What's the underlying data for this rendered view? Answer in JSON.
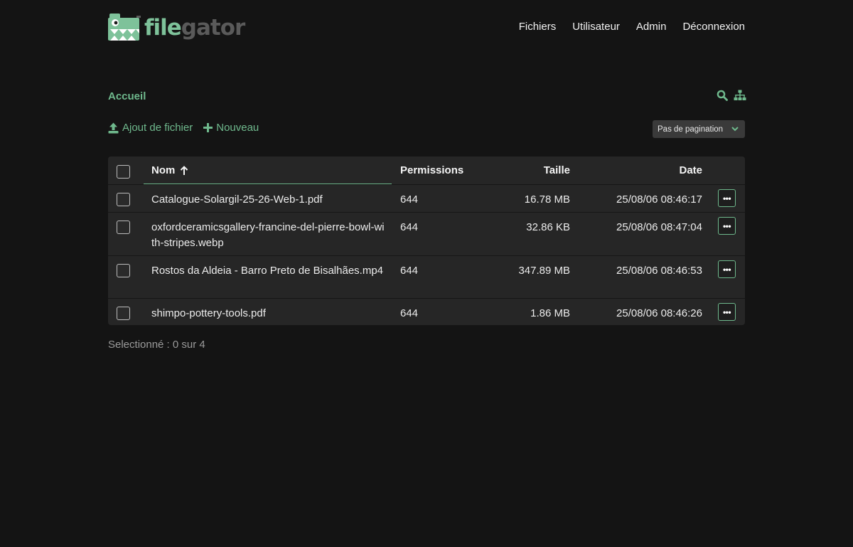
{
  "app": {
    "logo_text_1": "file",
    "logo_text_2": "gator",
    "brand_color": "#6fb98d"
  },
  "nav": {
    "items": [
      {
        "label": "Fichiers"
      },
      {
        "label": "Utilisateur"
      },
      {
        "label": "Admin"
      },
      {
        "label": "Déconnexion"
      }
    ]
  },
  "breadcrumb": {
    "home": "Accueil"
  },
  "toolbar": {
    "icons": [
      "search-icon",
      "sitemap-icon"
    ],
    "upload_label": "Ajout de fichier",
    "new_label": "Nouveau",
    "pagination_label": "Pas de pagination"
  },
  "table": {
    "headers": {
      "name": "Nom",
      "permissions": "Permissions",
      "size": "Taille",
      "date": "Date"
    },
    "rows": [
      {
        "name": "Catalogue-Solargil-25-26-Web-1.pdf",
        "permissions": "644",
        "size": "16.78 MB",
        "date": "25/08/06 08:46:17"
      },
      {
        "name": "oxfordceramicsgallery-francine-del-pierre-bowl-with-stripes.webp",
        "permissions": "644",
        "size": "32.86 KB",
        "date": "25/08/06 08:47:04"
      },
      {
        "name": "Rostos da Aldeia - Barro Preto de Bisalhães.mp4",
        "permissions": "644",
        "size": "347.89 MB",
        "date": "25/08/06 08:46:53"
      },
      {
        "name": "shimpo-pottery-tools.pdf",
        "permissions": "644",
        "size": "1.86 MB",
        "date": "25/08/06 08:46:26"
      }
    ]
  },
  "status": {
    "selected_text": "Selectionné : 0 sur 4"
  }
}
